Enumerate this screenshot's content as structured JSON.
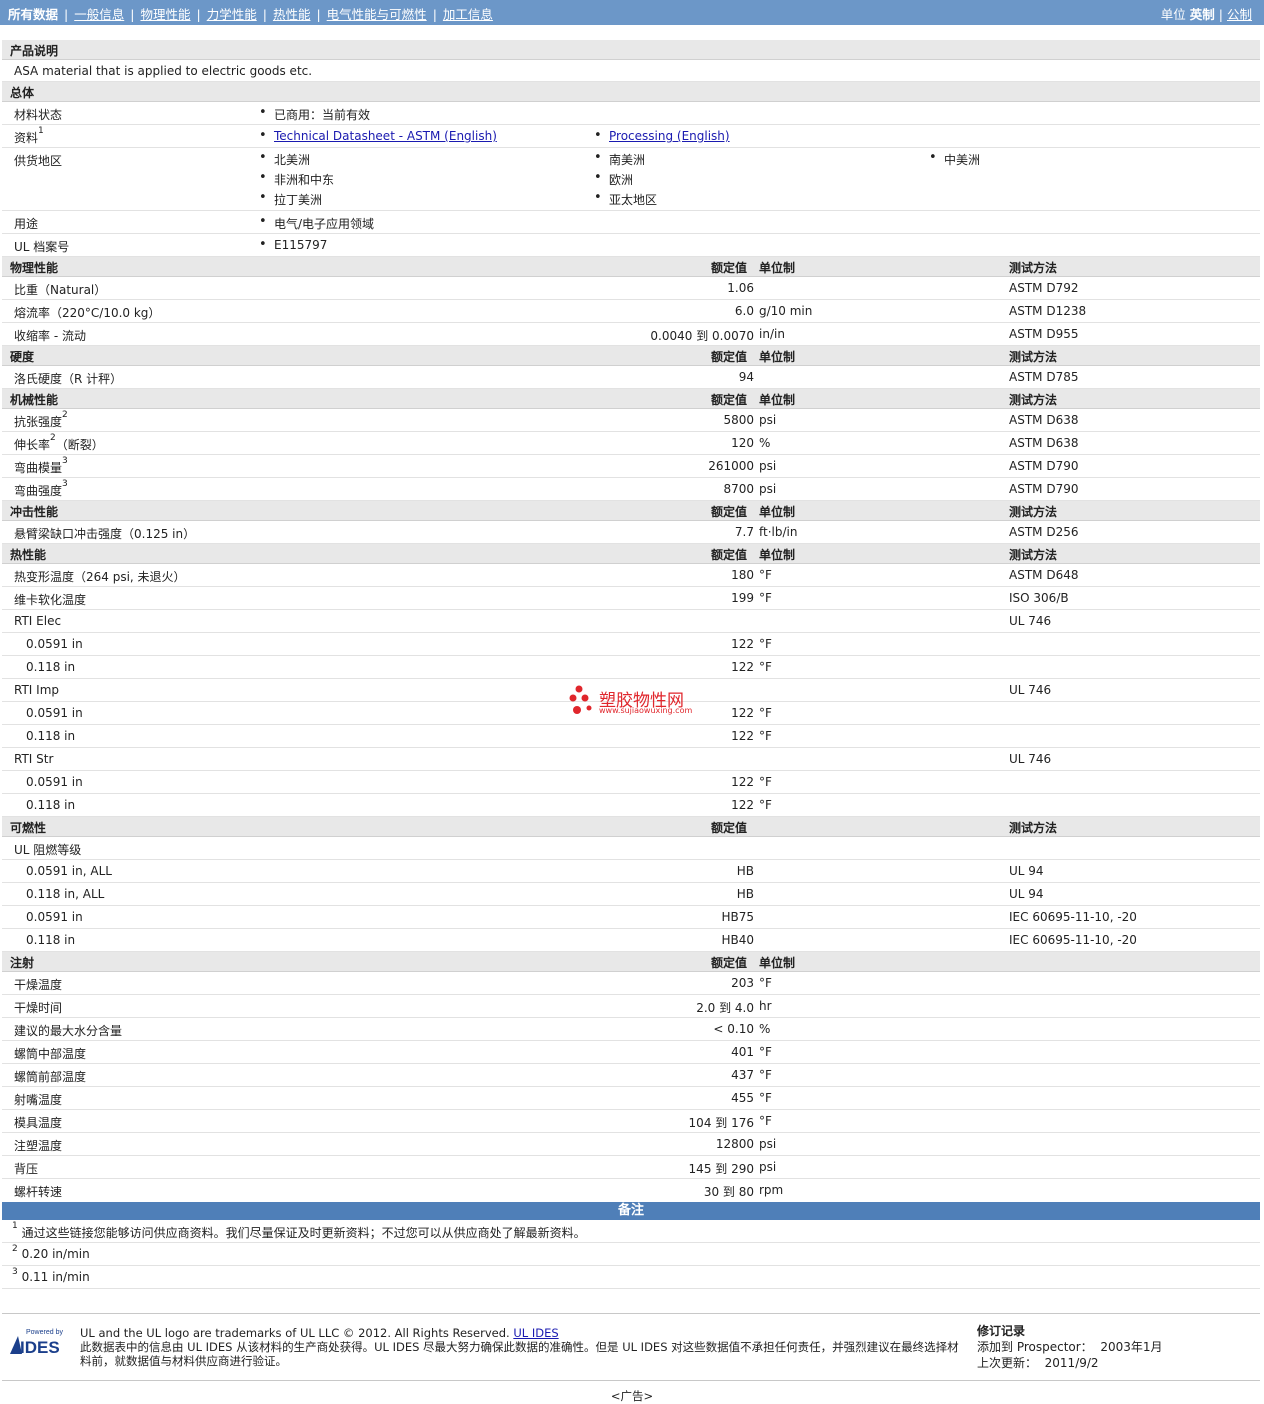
{
  "nav": {
    "items": [
      "所有数据",
      "一般信息",
      "物理性能",
      "力学性能",
      "热性能",
      "电气性能与可燃性",
      "加工信息"
    ],
    "units_label": "单位",
    "unit_current": "英制",
    "unit_alt": "公制"
  },
  "description": {
    "header": "产品说明",
    "text": "ASA material that is applied to electric goods etc."
  },
  "general": {
    "header": "总体",
    "status_label": "材料状态",
    "status_value": "已商用：当前有效",
    "docs_label": "资料",
    "docs_sup": "1",
    "doc1": "Technical Datasheet - ASTM (English)",
    "doc2": "Processing (English)",
    "regions_label": "供货地区",
    "regions": [
      "北美洲",
      "南美洲",
      "中美洲",
      "非洲和中东",
      "欧洲",
      "拉丁美洲",
      "亚太地区"
    ],
    "use_label": "用途",
    "use_value": "电气/电子应用领域",
    "ul_label": "UL 档案号",
    "ul_value": "E115797"
  },
  "col_headers": {
    "value": "额定值",
    "unit": "单位制",
    "method": "测试方法"
  },
  "physical": {
    "header": "物理性能",
    "rows": [
      {
        "name": "比重（Natural）",
        "value": "1.06",
        "unit": "",
        "method": "ASTM D792"
      },
      {
        "name": "熔流率（220°C/10.0 kg）",
        "value": "6.0",
        "unit": "g/10 min",
        "method": "ASTM D1238"
      },
      {
        "name": "收缩率 - 流动",
        "value": "0.0040 到  0.0070",
        "unit": "in/in",
        "method": "ASTM D955"
      }
    ]
  },
  "hardness": {
    "header": "硬度",
    "rows": [
      {
        "name": "洛氏硬度（R 计秤）",
        "value": "94",
        "unit": "",
        "method": "ASTM D785"
      }
    ]
  },
  "mechanical": {
    "header": "机械性能",
    "rows": [
      {
        "name": "抗张强度",
        "sup": "2",
        "suffix": "",
        "value": "5800",
        "unit": "psi",
        "method": "ASTM D638"
      },
      {
        "name": "伸长率",
        "sup": "2",
        "suffix": "（断裂）",
        "value": "120",
        "unit": "%",
        "method": "ASTM D638"
      },
      {
        "name": "弯曲模量",
        "sup": "3",
        "suffix": "",
        "value": "261000",
        "unit": "psi",
        "method": "ASTM D790"
      },
      {
        "name": "弯曲强度",
        "sup": "3",
        "suffix": "",
        "value": "8700",
        "unit": "psi",
        "method": "ASTM D790"
      }
    ]
  },
  "impact": {
    "header": "冲击性能",
    "rows": [
      {
        "name": "悬臂梁缺口冲击强度（0.125 in）",
        "value": "7.7",
        "unit": "ft·lb/in",
        "method": "ASTM D256"
      }
    ]
  },
  "thermal": {
    "header": "热性能",
    "rows": [
      {
        "name": "热变形温度（264 psi, 未退火）",
        "value": "180",
        "unit": "°F",
        "method": "ASTM D648"
      },
      {
        "name": "维卡软化温度",
        "value": "199",
        "unit": "°F",
        "method": "ISO 306/B"
      },
      {
        "name": "RTI Elec",
        "value": "",
        "unit": "",
        "method": "UL 746"
      },
      {
        "name": "0.0591 in",
        "value": "122",
        "unit": "°F",
        "method": ""
      },
      {
        "name": "0.118 in",
        "value": "122",
        "unit": "°F",
        "method": ""
      },
      {
        "name": "RTI Imp",
        "value": "",
        "unit": "",
        "method": "UL 746"
      },
      {
        "name": "0.0591 in",
        "value": "122",
        "unit": "°F",
        "method": ""
      },
      {
        "name": "0.118 in",
        "value": "122",
        "unit": "°F",
        "method": ""
      },
      {
        "name": "RTI Str",
        "value": "",
        "unit": "",
        "method": "UL 746"
      },
      {
        "name": "0.0591 in",
        "value": "122",
        "unit": "°F",
        "method": ""
      },
      {
        "name": "0.118 in",
        "value": "122",
        "unit": "°F",
        "method": ""
      }
    ]
  },
  "flammability": {
    "header": "可燃性",
    "rows": [
      {
        "name": "UL 阻燃等级",
        "value": "",
        "unit": "",
        "method": ""
      },
      {
        "name": "0.0591 in, ALL",
        "value": "HB",
        "unit": "",
        "method": "UL 94"
      },
      {
        "name": "0.118 in, ALL",
        "value": "HB",
        "unit": "",
        "method": "UL 94"
      },
      {
        "name": "0.0591 in",
        "value": "HB75",
        "unit": "",
        "method": "IEC 60695-11-10, -20"
      },
      {
        "name": "0.118 in",
        "value": "HB40",
        "unit": "",
        "method": "IEC 60695-11-10, -20"
      }
    ]
  },
  "injection": {
    "header": "注射",
    "rows": [
      {
        "name": "干燥温度",
        "value": "203",
        "unit": "°F"
      },
      {
        "name": "干燥时间",
        "value": "2.0 到  4.0",
        "unit": "hr"
      },
      {
        "name": "建议的最大水分含量",
        "value": "< 0.10",
        "unit": "%"
      },
      {
        "name": "螺筒中部温度",
        "value": "401",
        "unit": "°F"
      },
      {
        "name": "螺筒前部温度",
        "value": "437",
        "unit": "°F"
      },
      {
        "name": "射嘴温度",
        "value": "455",
        "unit": "°F"
      },
      {
        "name": "模具温度",
        "value": "104 到  176",
        "unit": "°F"
      },
      {
        "name": "注塑温度",
        "value": "12800",
        "unit": "psi"
      },
      {
        "name": "背压",
        "value": "145 到  290",
        "unit": "psi"
      },
      {
        "name": "螺杆转速",
        "value": "30 到  80",
        "unit": "rpm"
      }
    ]
  },
  "notes": {
    "header": "备注",
    "items": [
      {
        "num": "1",
        "text": "通过这些链接您能够访问供应商资料。我们尽量保证及时更新资料；不过您可以从供应商处了解最新资料。"
      },
      {
        "num": "2",
        "text": "0.20 in/min"
      },
      {
        "num": "3",
        "text": "0.11 in/min"
      }
    ]
  },
  "footer": {
    "logo_powered": "Powered by",
    "logo_text": "IDES",
    "line1": "UL and the UL logo are trademarks of UL LLC © 2012. All Rights Reserved.",
    "link": "UL IDES",
    "line2": "此数据表中的信息由 UL IDES 从该材料的生产商处获得。UL IDES 尽最大努力确保此数据的准确性。但是 UL IDES 对这些数据值不承担任何责任，并强烈建议在最终选择材料前，就数据值与材料供应商进行验证。",
    "rev_header": "修订记录",
    "rev_added_label": "添加到 Prospector：",
    "rev_added_date": "2003年1月",
    "rev_updated_label": "上次更新：",
    "rev_updated_date": "2011/9/2"
  },
  "watermark": {
    "cn": "塑胶物性网",
    "url": "www.sujiaowuxing.com"
  },
  "ad_label": "<广告>",
  "colors": {
    "nav_bg": "#6c97c8",
    "notes_bg": "#4f7fb8",
    "section_bg": "#e8e8e8",
    "link": "#1a1ab0"
  }
}
